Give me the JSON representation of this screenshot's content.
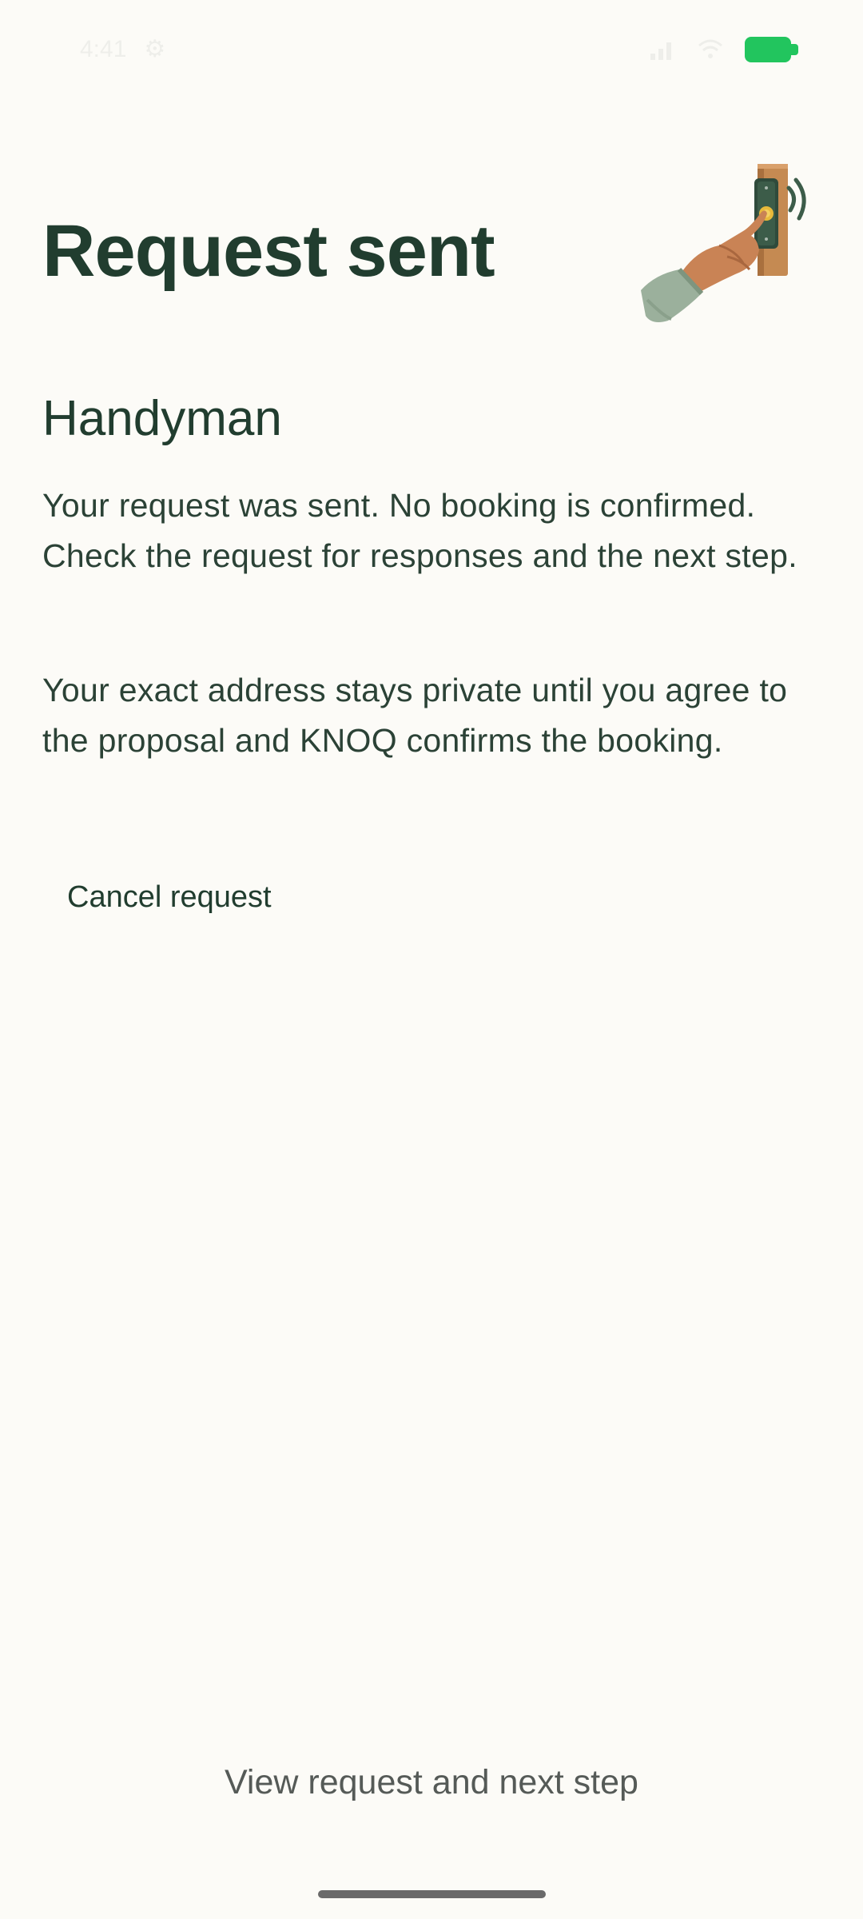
{
  "status_bar": {
    "time": "4:41",
    "battery_color": "#22C55E",
    "icons": [
      "settings-icon",
      "signal-icon",
      "wifi-icon",
      "battery-icon"
    ]
  },
  "header": {
    "title": "Request sent",
    "illustration": "doorbell-press-icon"
  },
  "request": {
    "service": "Handyman",
    "message": "Your request was sent. No booking is confirmed. Check the request for responses and the next step.",
    "privacy_note": "Your exact address stays private until you agree to the proposal and KNOQ confirms the booking."
  },
  "actions": {
    "cancel_label": "Cancel request",
    "primary_label": "View request and next step"
  },
  "colors": {
    "background": "#FCFBF7",
    "heading": "#213D2F",
    "body_text": "#2B4236",
    "primary_text": "#555A57"
  }
}
